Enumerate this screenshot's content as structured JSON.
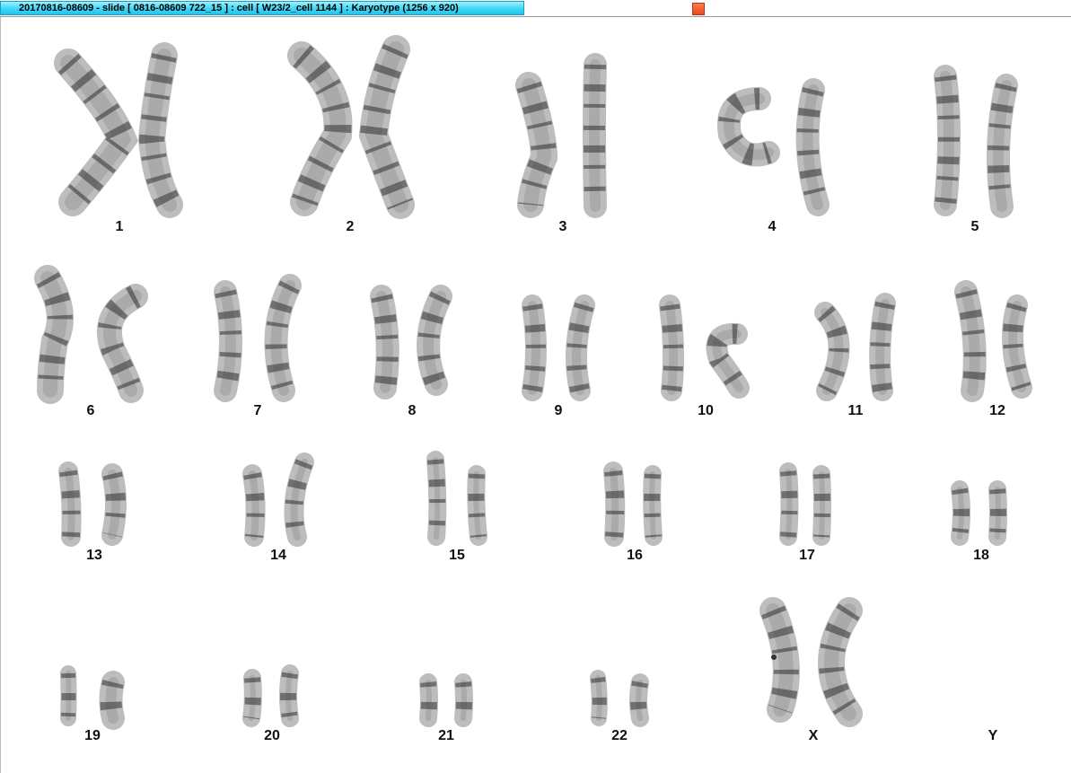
{
  "window": {
    "title": "20170816-08609 - slide [ 0816-08609 722_15 ] : cell [ W23/2_cell 1144 ] : Karyotype  (1256 x 920)"
  },
  "karyotype": {
    "chromosomes": [
      {
        "label": "1"
      },
      {
        "label": "2"
      },
      {
        "label": "3"
      },
      {
        "label": "4"
      },
      {
        "label": "5"
      },
      {
        "label": "6"
      },
      {
        "label": "7"
      },
      {
        "label": "8"
      },
      {
        "label": "9"
      },
      {
        "label": "10"
      },
      {
        "label": "11"
      },
      {
        "label": "12"
      },
      {
        "label": "13"
      },
      {
        "label": "14"
      },
      {
        "label": "15"
      },
      {
        "label": "16"
      },
      {
        "label": "17"
      },
      {
        "label": "18"
      },
      {
        "label": "19"
      },
      {
        "label": "20"
      },
      {
        "label": "21"
      },
      {
        "label": "22"
      },
      {
        "label": "X"
      },
      {
        "label": "Y"
      }
    ]
  }
}
